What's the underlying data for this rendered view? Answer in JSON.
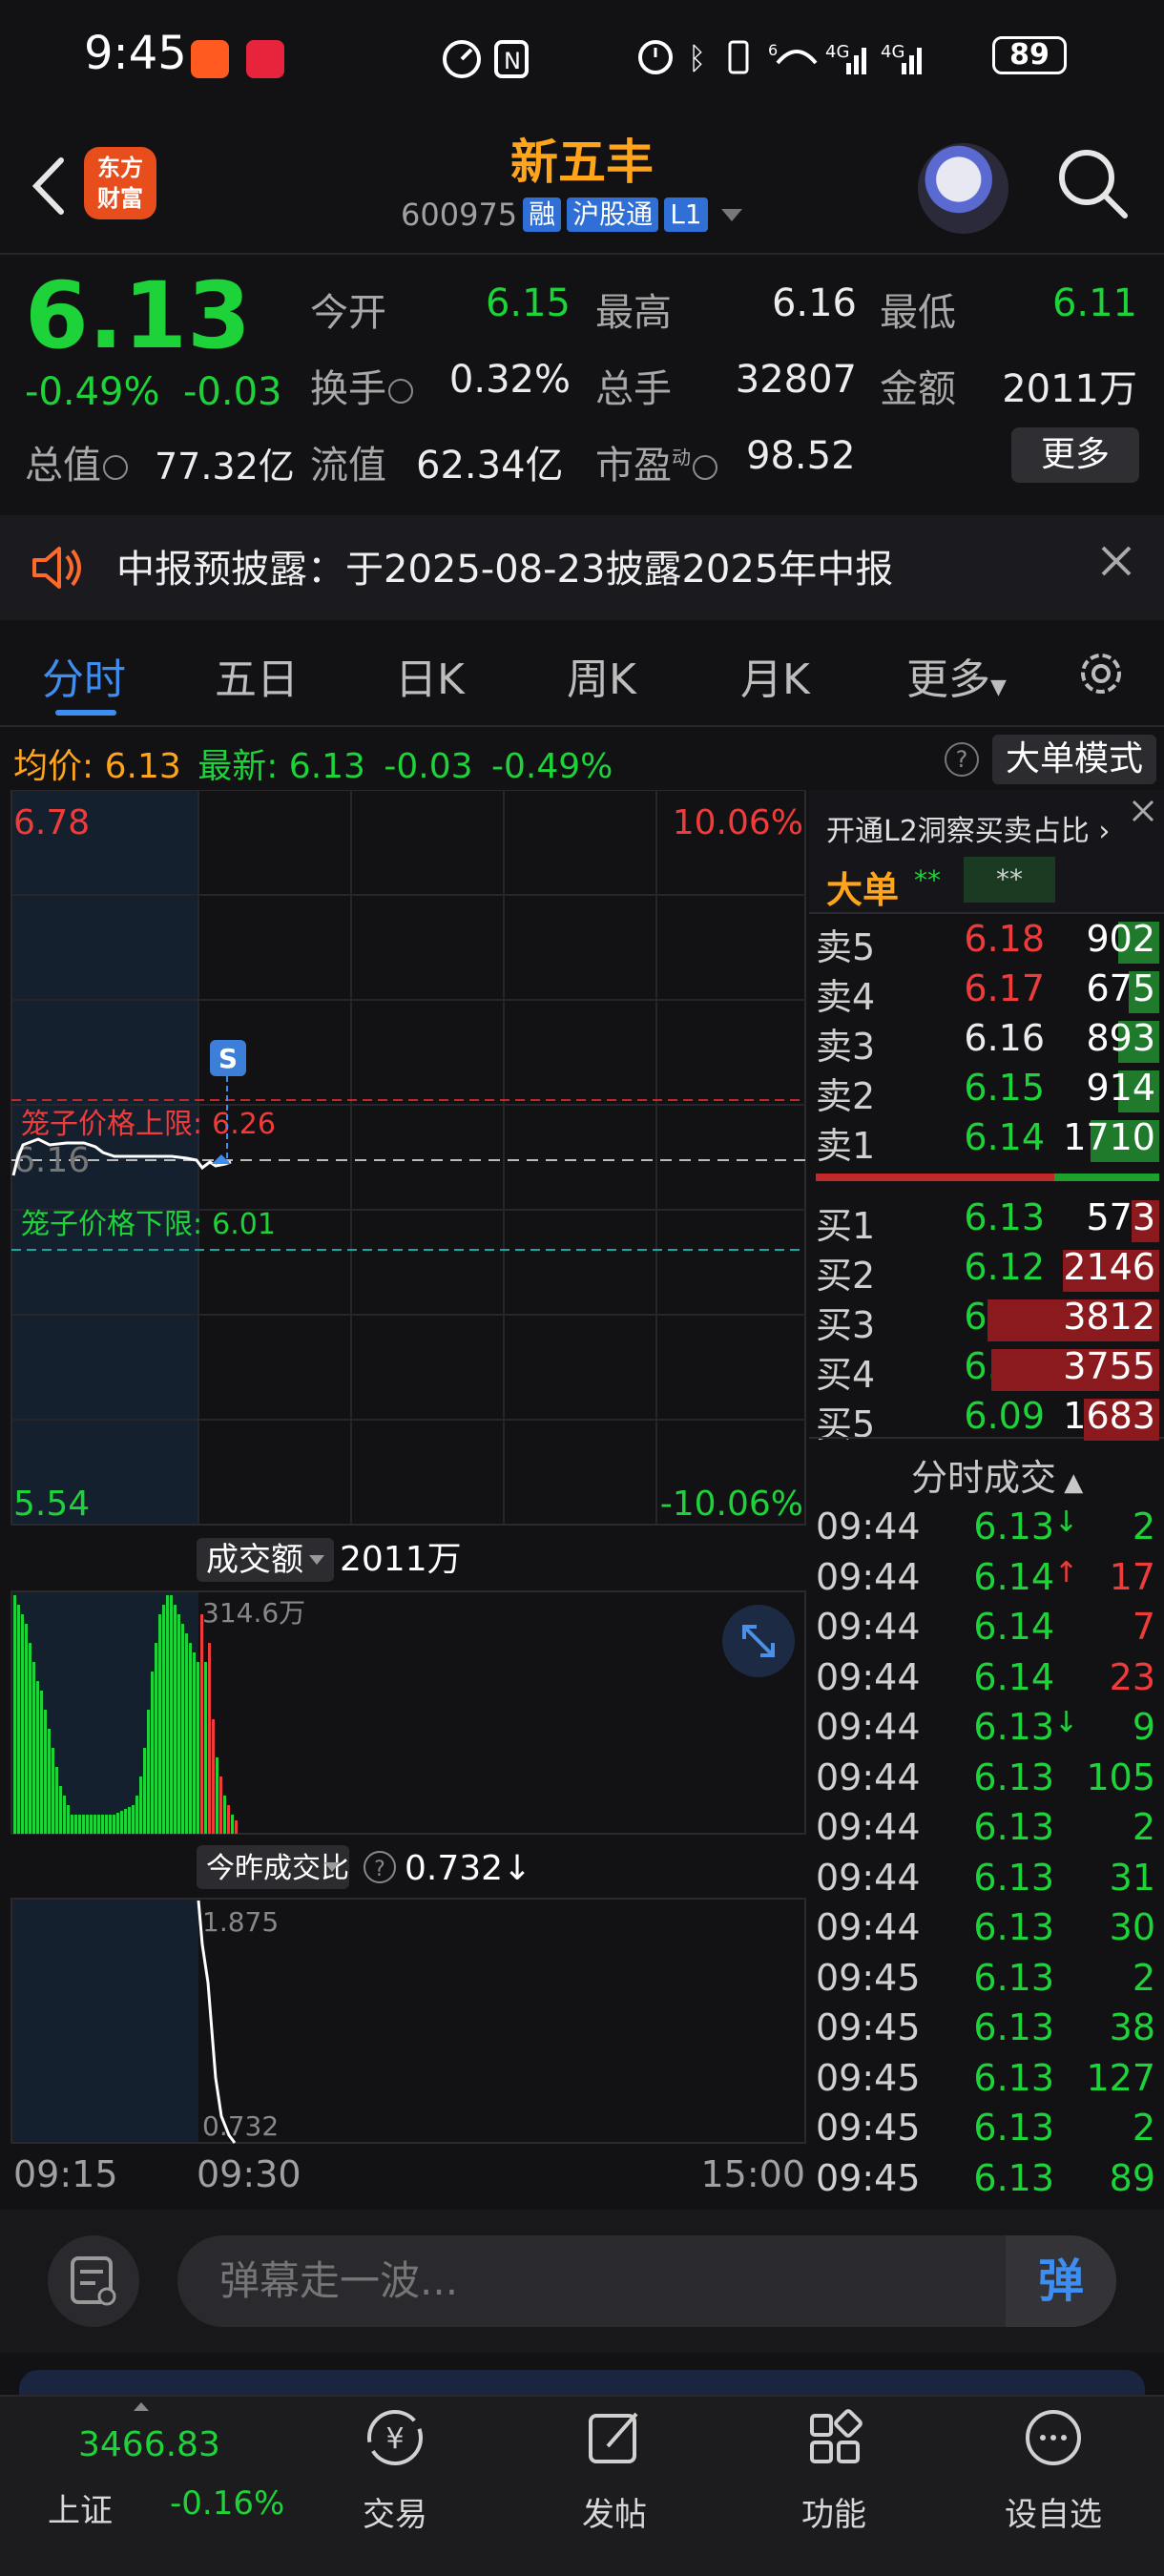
{
  "status_bar": {
    "time": "9:45",
    "battery": "89",
    "net1": "4G",
    "net2": "4G",
    "wifi_num": "6"
  },
  "header": {
    "logo_line1": "东方",
    "logo_line2": "财富",
    "stock_name": "新五丰",
    "stock_code": "600975",
    "tags": [
      "融",
      "沪股通",
      "L1"
    ]
  },
  "quote": {
    "price": "6.13",
    "change_pct": "-0.49%",
    "change_amt": "-0.03",
    "open_label": "今开",
    "open": "6.15",
    "high_label": "最高",
    "high": "6.16",
    "low_label": "最低",
    "low": "6.11",
    "turnover_label": "换手",
    "turnover": "0.32%",
    "volume_label": "总手",
    "volume": "32807",
    "amount_label": "金额",
    "amount": "2011万",
    "mktcap_label": "总值",
    "mktcap": "77.32亿",
    "float_label": "流值",
    "float": "62.34亿",
    "pe_label": "市盈",
    "pe_sup": "动",
    "pe": "98.52",
    "more_label": "更多"
  },
  "notice": {
    "text": "中报预披露：于2025-08-23披露2025年中报"
  },
  "tabs": [
    {
      "label": "分时",
      "active": true
    },
    {
      "label": "五日"
    },
    {
      "label": "日K"
    },
    {
      "label": "周K"
    },
    {
      "label": "月K"
    },
    {
      "label": "更多"
    }
  ],
  "avg_bar": {
    "avg_label": "均价:",
    "avg": "6.13",
    "latest_label": "最新:",
    "latest": "6.13",
    "chg": "-0.03",
    "pct": "-0.49%",
    "help": "?",
    "mode_button": "大单模式"
  },
  "chart": {
    "price_top": "6.78",
    "price_bottom": "5.54",
    "pct_top": "10.06%",
    "pct_bottom": "-10.06%",
    "ref_price": "6.16",
    "upper_limit_label": "笼子价格上限:",
    "upper_limit": "6.26",
    "lower_limit_label": "笼子价格下限:",
    "lower_limit": "6.01",
    "marker": "S",
    "volume_selector": "成交额",
    "volume_total": "2011万",
    "volume_max": "314.6万",
    "ratio_selector": "今昨成交比",
    "ratio_value": "0.732↓",
    "ratio_top": "1.875",
    "ratio_bottom": "0.732",
    "time_start": "09:15",
    "time_mid": "09:30",
    "time_end": "15:00",
    "colors": {
      "up": "#f03b3b",
      "down": "#1ed23a",
      "line": "#ffffff"
    }
  },
  "order_book": {
    "l2_link": "开通L2洞察买卖占比",
    "big_label": "大单",
    "big_val1": "**",
    "big_val2": "**",
    "asks": [
      {
        "label": "卖5",
        "price": "6.18",
        "vol": "902",
        "color": "red",
        "bar": 0.12
      },
      {
        "label": "卖4",
        "price": "6.17",
        "vol": "675",
        "color": "red",
        "bar": 0.09
      },
      {
        "label": "卖3",
        "price": "6.16",
        "vol": "893",
        "color": "white",
        "bar": 0.12
      },
      {
        "label": "卖2",
        "price": "6.15",
        "vol": "914",
        "color": "green",
        "bar": 0.12
      },
      {
        "label": "卖1",
        "price": "6.14",
        "vol": "1710",
        "color": "green",
        "bar": 0.2
      }
    ],
    "bids": [
      {
        "label": "买1",
        "price": "6.13",
        "vol": "573",
        "color": "green",
        "bar": 0.08
      },
      {
        "label": "买2",
        "price": "6.12",
        "vol": "2146",
        "color": "green",
        "bar": 0.28
      },
      {
        "label": "买3",
        "price": "6.11",
        "vol": "3812",
        "color": "green",
        "bar": 0.5
      },
      {
        "label": "买4",
        "price": "6.10",
        "vol": "3755",
        "color": "green",
        "bar": 0.49
      },
      {
        "label": "买5",
        "price": "6.09",
        "vol": "1683",
        "color": "green",
        "bar": 0.22
      }
    ],
    "trades_header": "分时成交",
    "trades": [
      {
        "time": "09:44",
        "price": "6.13",
        "arrow": "↓",
        "arrow_color": "green",
        "vol": "2",
        "vol_color": "green"
      },
      {
        "time": "09:44",
        "price": "6.14",
        "arrow": "↑",
        "arrow_color": "red",
        "vol": "17",
        "vol_color": "red"
      },
      {
        "time": "09:44",
        "price": "6.14",
        "arrow": "",
        "arrow_color": "red",
        "vol": "7",
        "vol_color": "red"
      },
      {
        "time": "09:44",
        "price": "6.14",
        "arrow": "",
        "arrow_color": "red",
        "vol": "23",
        "vol_color": "red"
      },
      {
        "time": "09:44",
        "price": "6.13",
        "arrow": "↓",
        "arrow_color": "green",
        "vol": "9",
        "vol_color": "green"
      },
      {
        "time": "09:44",
        "price": "6.13",
        "arrow": "",
        "arrow_color": "green",
        "vol": "105",
        "vol_color": "green"
      },
      {
        "time": "09:44",
        "price": "6.13",
        "arrow": "",
        "arrow_color": "green",
        "vol": "2",
        "vol_color": "green"
      },
      {
        "time": "09:44",
        "price": "6.13",
        "arrow": "",
        "arrow_color": "green",
        "vol": "31",
        "vol_color": "green"
      },
      {
        "time": "09:44",
        "price": "6.13",
        "arrow": "",
        "arrow_color": "green",
        "vol": "30",
        "vol_color": "green"
      },
      {
        "time": "09:45",
        "price": "6.13",
        "arrow": "",
        "arrow_color": "green",
        "vol": "2",
        "vol_color": "green"
      },
      {
        "time": "09:45",
        "price": "6.13",
        "arrow": "",
        "arrow_color": "green",
        "vol": "38",
        "vol_color": "green"
      },
      {
        "time": "09:45",
        "price": "6.13",
        "arrow": "",
        "arrow_color": "green",
        "vol": "127",
        "vol_color": "green"
      },
      {
        "time": "09:45",
        "price": "6.13",
        "arrow": "",
        "arrow_color": "green",
        "vol": "2",
        "vol_color": "green"
      },
      {
        "time": "09:45",
        "price": "6.13",
        "arrow": "",
        "arrow_color": "green",
        "vol": "89",
        "vol_color": "green"
      }
    ]
  },
  "danmaku": {
    "placeholder": "弹幕走一波...",
    "send": "弹"
  },
  "bottom_nav": {
    "index_value": "3466.83",
    "index_name": "上证",
    "index_chg": "-0.16%",
    "items": [
      {
        "label": "交易",
        "icon": "trade-icon"
      },
      {
        "label": "发帖",
        "icon": "post-icon"
      },
      {
        "label": "功能",
        "icon": "function-icon"
      },
      {
        "label": "设自选",
        "icon": "watchlist-icon"
      }
    ]
  }
}
